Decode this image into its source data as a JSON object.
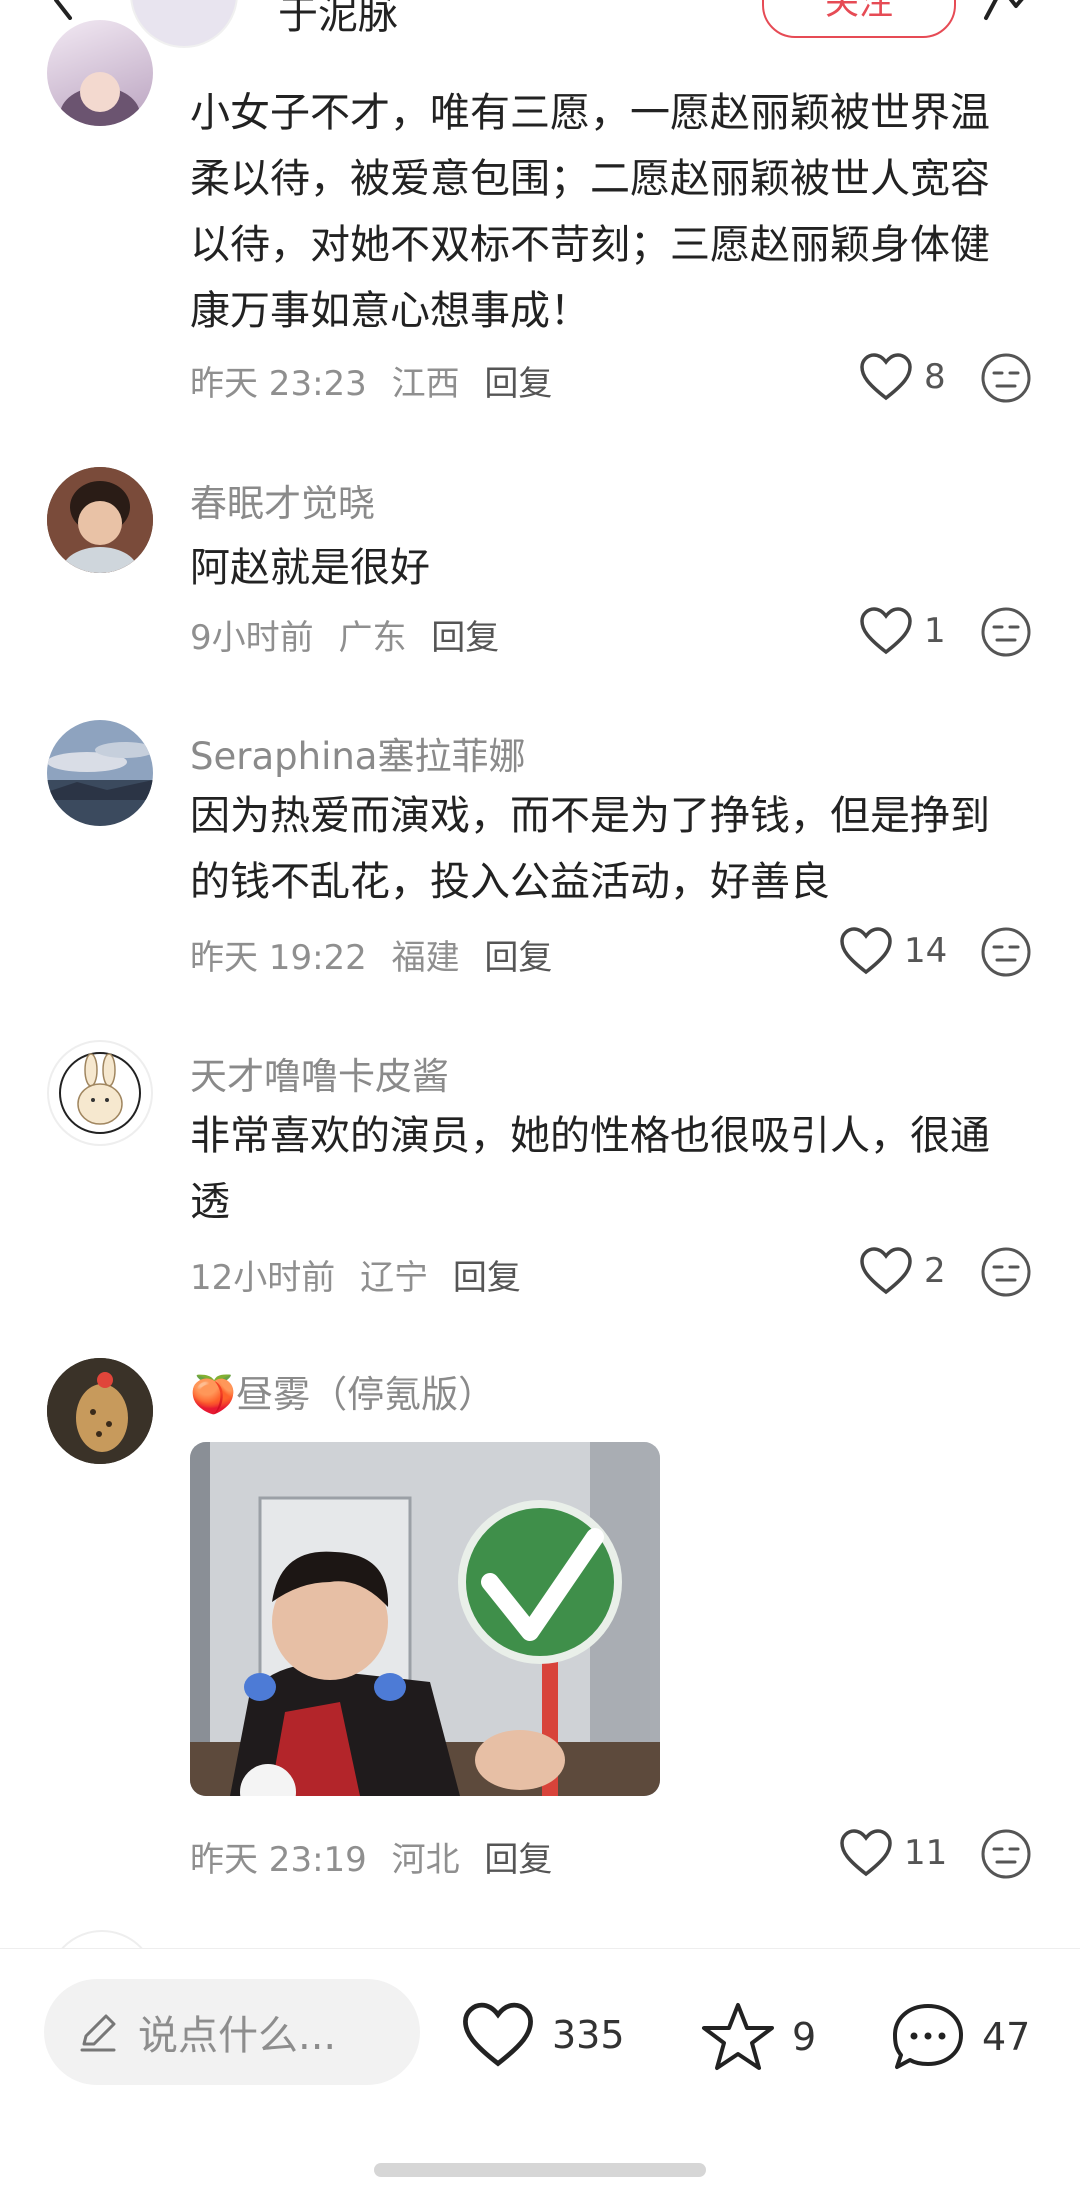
{
  "header": {
    "author_name": "于泥脉",
    "follow_label": "关注"
  },
  "comments": [
    {
      "username": "",
      "text": "小女子不才，唯有三愿，一愿赵丽颖被世界温柔以待，被爱意包围；二愿赵丽颖被世人宽容以待，对她不双标不苛刻；三愿赵丽颖身体健康万事如意心想事成！",
      "time": "昨天 23:23",
      "location": "江西",
      "reply_label": "回复",
      "likes": "8"
    },
    {
      "username": "春眠才觉晓",
      "text": "阿赵就是很好",
      "time": "9小时前",
      "location": "广东",
      "reply_label": "回复",
      "likes": "1"
    },
    {
      "username": "Seraphina塞拉菲娜",
      "text": "因为热爱而演戏，而不是为了挣钱，但是挣到的钱不乱花，投入公益活动，好善良",
      "time": "昨天 19:22",
      "location": "福建",
      "reply_label": "回复",
      "likes": "14"
    },
    {
      "username": "天才噜噜卡皮酱",
      "text": "非常喜欢的演员，她的性格也很吸引人，很通透",
      "time": "12小时前",
      "location": "辽宁",
      "reply_label": "回复",
      "likes": "2"
    },
    {
      "username": "🍑昼雾（停氪版）",
      "text": "",
      "time": "昨天 23:19",
      "location": "河北",
      "reply_label": "回复",
      "likes": "11"
    }
  ],
  "bottom_bar": {
    "input_placeholder": "说点什么...",
    "like_count": "335",
    "star_count": "9",
    "comment_count": "47"
  },
  "colors": {
    "accent": "#e64b55",
    "meta_text": "#8f8f8f",
    "sticker_green": "#3f8f4a"
  }
}
